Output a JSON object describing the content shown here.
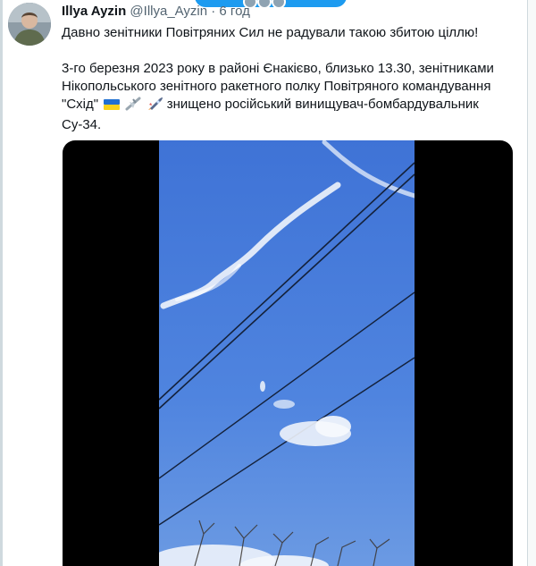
{
  "tweet": {
    "author_name": "Illya Ayzin",
    "handle": "@Illya_Ayzin",
    "separator": "·",
    "time": "6 год",
    "text_line1": "Давно зенітники Повітряних Сил не радували такою збитою ціллю!",
    "text_para2": "3-го березня 2023 року в районі Єнакієво, близько 13.30, зенітниками Нікопольського зенітного ракетного полку Повітряного командування \"Схід\"",
    "text_para2_end": "знищено російський винищувач-бомбардувальник Су-34.",
    "emojis": [
      "ukraine-flag-icon",
      "airplane-icon",
      "rocket-icon"
    ]
  },
  "media": {
    "type": "video",
    "content": "sky with contrails, power lines and falling aircraft"
  },
  "colors": {
    "accent": "#1d9bf0",
    "text": "#0f1419",
    "secondary": "#536471",
    "sky": "#4f7dd8"
  }
}
